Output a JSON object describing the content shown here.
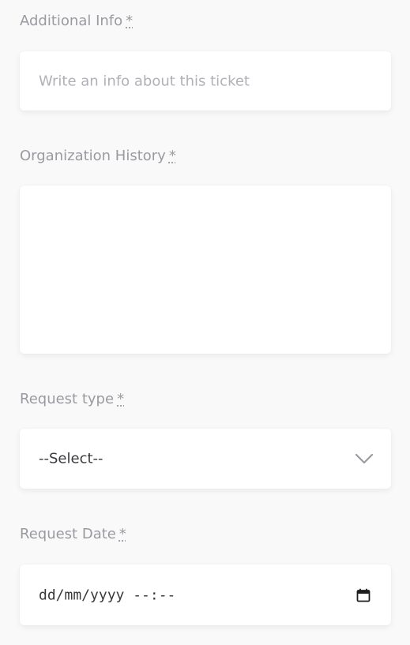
{
  "form": {
    "additional_info": {
      "label": "Additional Info",
      "required_mark": "*",
      "placeholder": "Write an info about this ticket"
    },
    "organization_history": {
      "label": "Organization History",
      "required_mark": "*",
      "value": ""
    },
    "request_type": {
      "label": "Request type",
      "required_mark": "*",
      "selected": "--Select--"
    },
    "request_date": {
      "label": "Request Date",
      "required_mark": "*",
      "value": "dd/mm/yyyy --:--"
    }
  },
  "icons": {
    "select_arrow": "chevron-down-icon",
    "date_picker": "calendar-icon"
  },
  "colors": {
    "label": "#9a9aa0",
    "placeholder": "#b0b0b6",
    "text": "#3a3a3e",
    "background": "#f9f9fa",
    "field": "#ffffff"
  }
}
